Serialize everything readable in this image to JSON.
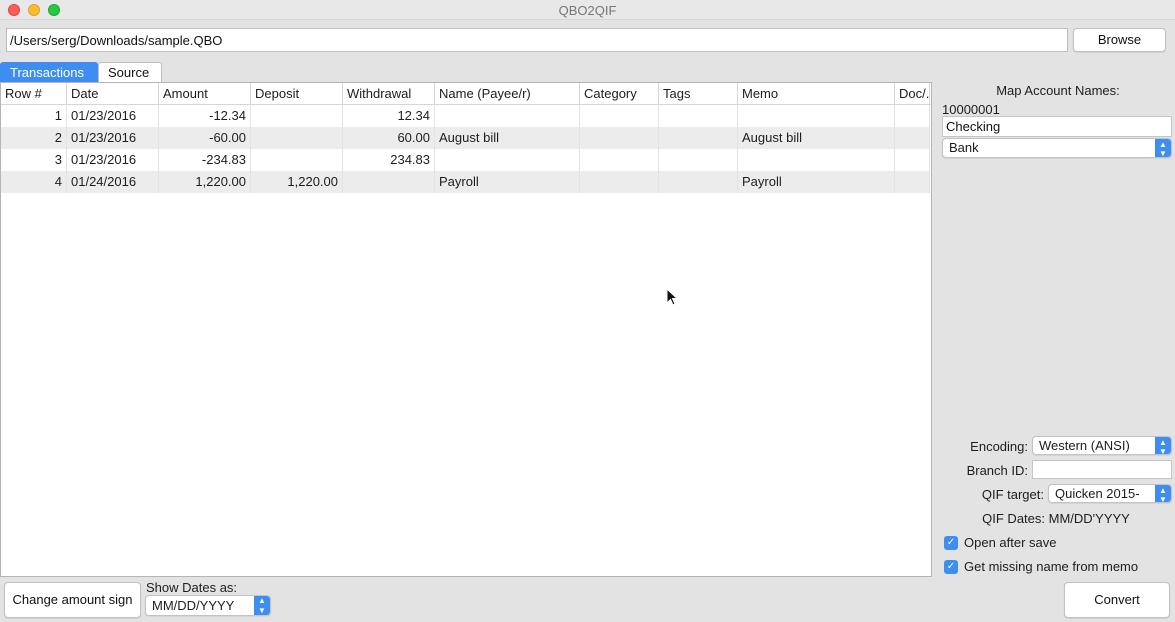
{
  "window": {
    "title": "QBO2QIF"
  },
  "file": {
    "path": "/Users/serg/Downloads/sample.QBO",
    "browse_label": "Browse"
  },
  "tabs": [
    {
      "label": "Transactions",
      "active": true
    },
    {
      "label": "Source",
      "active": false
    }
  ],
  "table": {
    "columns": [
      "Row #",
      "Date",
      "Amount",
      "Deposit",
      "Withdrawal",
      "Name (Payee/r)",
      "Category",
      "Tags",
      "Memo",
      "Doc/..."
    ],
    "rows": [
      {
        "row": "1",
        "date": "01/23/2016",
        "amount": "-12.34",
        "deposit": "",
        "withdrawal": "12.34",
        "name": "",
        "category": "",
        "tags": "",
        "memo": "",
        "doc": ""
      },
      {
        "row": "2",
        "date": "01/23/2016",
        "amount": "-60.00",
        "deposit": "",
        "withdrawal": "60.00",
        "name": "August bill",
        "category": "",
        "tags": "",
        "memo": "August bill",
        "doc": ""
      },
      {
        "row": "3",
        "date": "01/23/2016",
        "amount": "-234.83",
        "deposit": "",
        "withdrawal": "234.83",
        "name": "",
        "category": "",
        "tags": "",
        "memo": "",
        "doc": ""
      },
      {
        "row": "4",
        "date": "01/24/2016",
        "amount": "1,220.00",
        "deposit": "1,220.00",
        "withdrawal": "",
        "name": "Payroll",
        "category": "",
        "tags": "",
        "memo": "Payroll",
        "doc": ""
      }
    ]
  },
  "sidebar": {
    "map_title": "Map Account Names:",
    "account_number": "10000001",
    "account_name": "Checking",
    "account_type": "Bank",
    "encoding_label": "Encoding:",
    "encoding_value": "Western (ANSI)",
    "branch_label": "Branch ID:",
    "branch_value": "",
    "qif_target_label": "QIF target:",
    "qif_target_value": "Quicken 2015-",
    "qif_dates": "QIF Dates: MM/DD'YYYY",
    "open_after_save": "Open after save",
    "get_missing_name": "Get missing name from memo"
  },
  "bottom": {
    "change_sign_label": "Change amount sign",
    "show_dates_label": "Show Dates as:",
    "show_dates_value": "MM/DD/YYYY",
    "convert_label": "Convert"
  },
  "colors": {
    "accent": "#3d8ef0",
    "alt_row": "#ececec"
  },
  "icons": {
    "cursor": "arrow-cursor-icon",
    "dropdown": "chevron-updown-icon",
    "check": "checkmark-icon"
  }
}
